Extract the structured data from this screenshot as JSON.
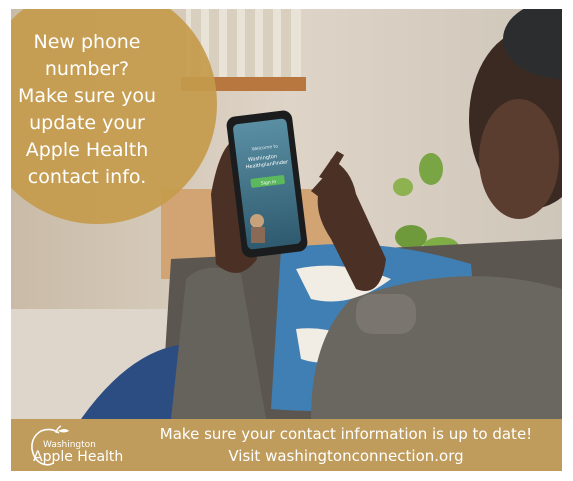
{
  "headline": {
    "lines": [
      "New phone",
      "number?",
      "Make sure you",
      "update your",
      "Apple Health",
      "contact info."
    ]
  },
  "phone_screen": {
    "welcome": "Welcome to",
    "app_name_line1": "Washington",
    "app_name_line2": "HealthplanFinder",
    "sign_in": "Sign in"
  },
  "logo": {
    "small_text": "Washington",
    "big_text": "Apple Health"
  },
  "footer": {
    "line1": "Make sure your contact information is up to date!",
    "line2": "Visit washingtonconnection.org"
  },
  "colors": {
    "gold_bubble": "#c49b4c",
    "footer_band": "#bf9c5c",
    "text": "#ffffff"
  }
}
